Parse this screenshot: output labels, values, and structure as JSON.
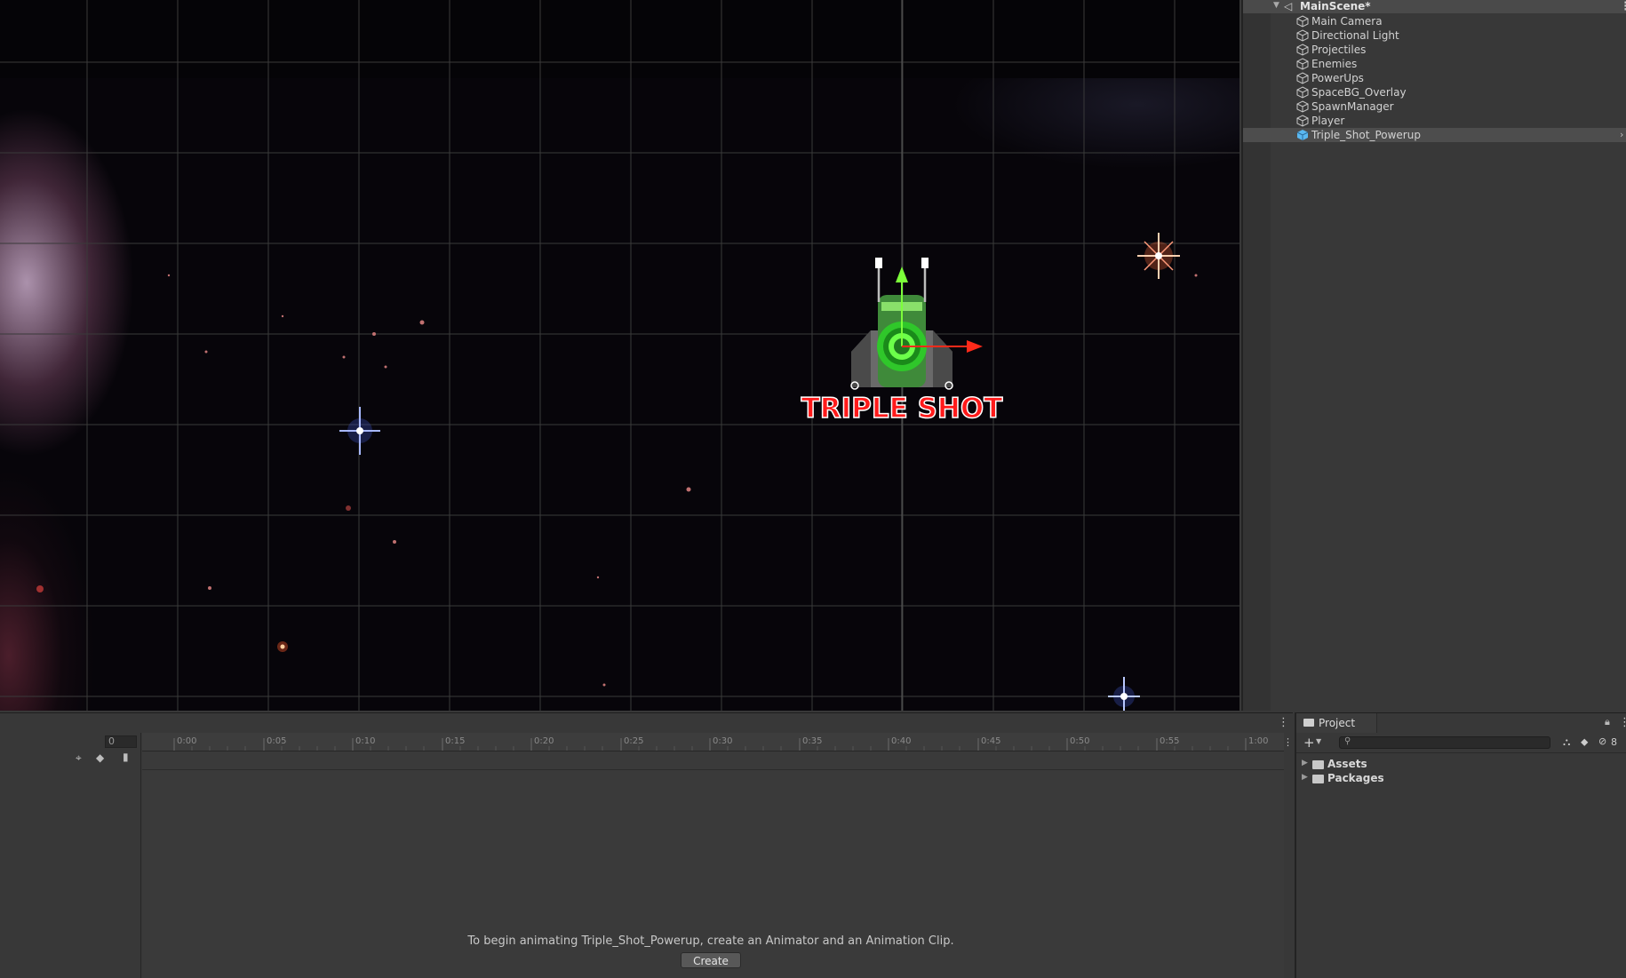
{
  "hierarchy": {
    "scene_name": "MainScene*",
    "items": [
      {
        "label": "Main Camera"
      },
      {
        "label": "Directional Light"
      },
      {
        "label": "Projectiles"
      },
      {
        "label": "Enemies"
      },
      {
        "label": "PowerUps"
      },
      {
        "label": "SpaceBG_Overlay"
      },
      {
        "label": "SpawnManager"
      },
      {
        "label": "Player"
      },
      {
        "label": "Triple_Shot_Powerup",
        "selected": true
      }
    ]
  },
  "scene_view": {
    "powerup_text": "TRIPLE SHOT"
  },
  "animation": {
    "frame_value": "0",
    "time_ticks": [
      "0:00",
      "0:05",
      "0:10",
      "0:15",
      "0:20",
      "0:25",
      "0:30",
      "0:35",
      "0:40",
      "0:45",
      "0:50",
      "0:55",
      "1:00"
    ],
    "begin_message": "To begin animating Triple_Shot_Powerup, create an Animator and an Animation Clip.",
    "create_label": "Create"
  },
  "project": {
    "tab_label": "Project",
    "hidden_count": "8",
    "folders": [
      {
        "label": "Assets"
      },
      {
        "label": "Packages"
      }
    ]
  },
  "colors": {
    "selection": "#4d4d4d",
    "panel": "#383838",
    "gizmo_green": "#7cff3a",
    "gizmo_red": "#ff2a1a"
  }
}
